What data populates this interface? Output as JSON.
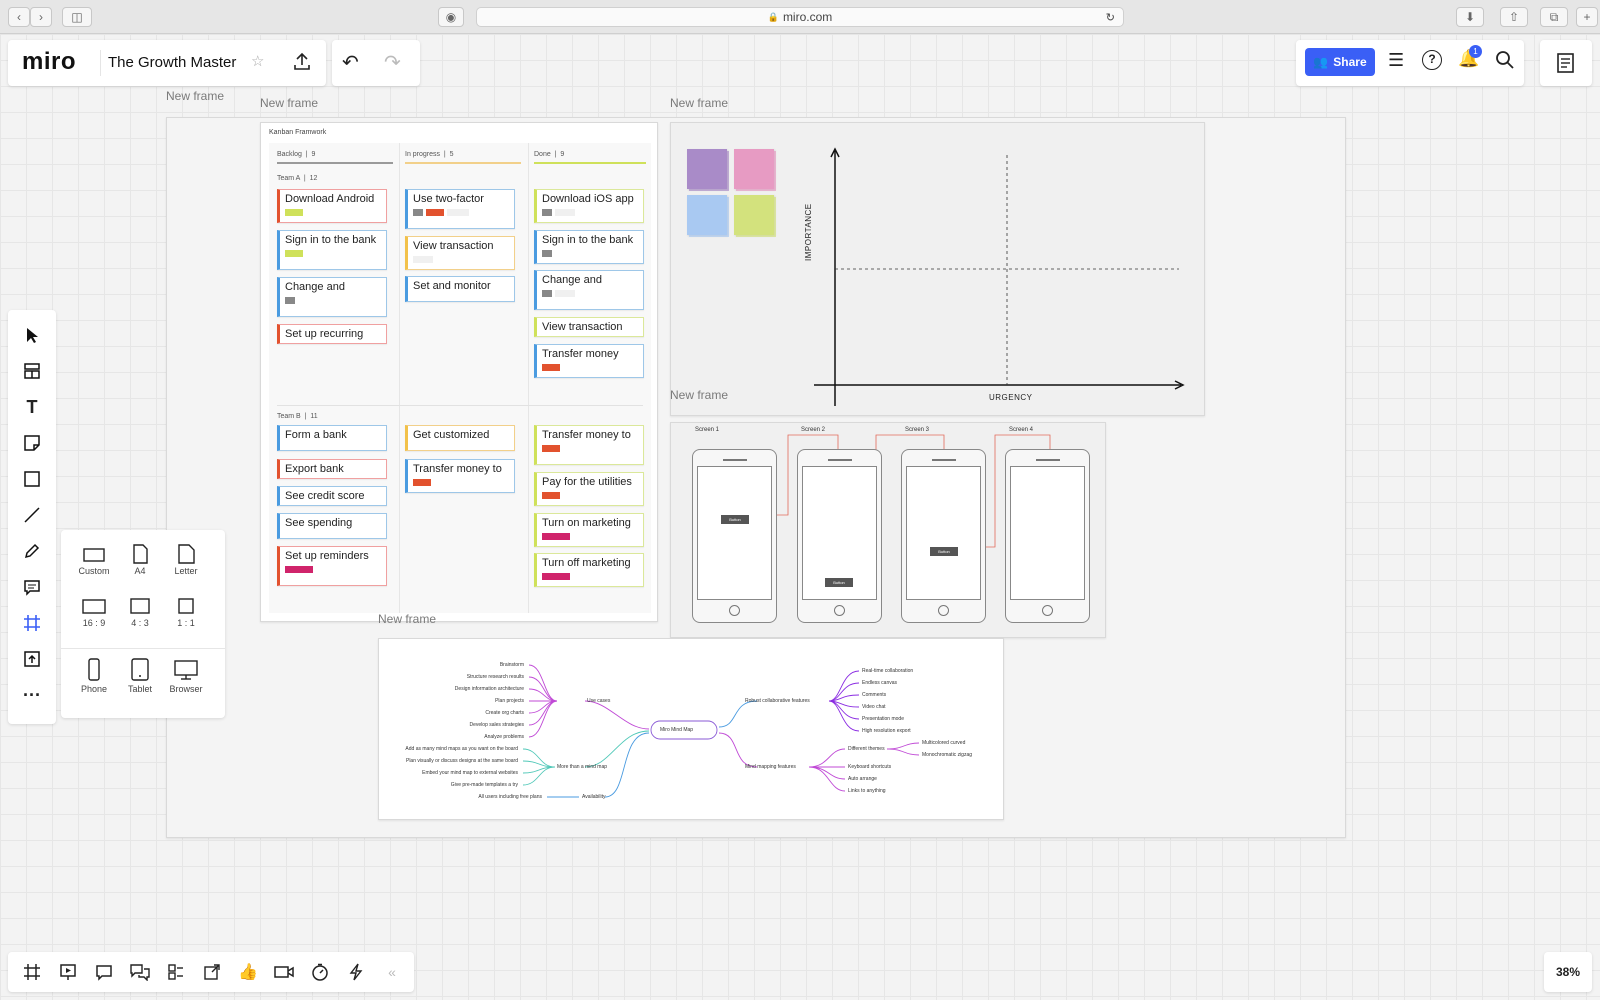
{
  "browser": {
    "url": "miro.com"
  },
  "app": {
    "logo": "miro",
    "board_title": "The Growth Master",
    "share_label": "Share",
    "notification_count": "1",
    "zoom": "38%"
  },
  "frames": {
    "outer_label": "New frame",
    "kanban_label": "New frame",
    "matrix_label": "New frame",
    "wireframe_label": "New frame",
    "mindmap_label": "New frame"
  },
  "kanban": {
    "title": "Kanban Framwork",
    "columns": [
      {
        "name": "Backlog",
        "count": "9"
      },
      {
        "name": "In progress",
        "count": "5"
      },
      {
        "name": "Done",
        "count": "9"
      }
    ],
    "team_a": {
      "name": "Team A",
      "count": "12"
    },
    "team_b": {
      "name": "Team B",
      "count": "11"
    },
    "cards": {
      "a_backlog": [
        "Download Android",
        "Sign in to the bank",
        "Change and",
        "Set up recurring"
      ],
      "a_progress": [
        "Use two-factor",
        "View transaction",
        "Set and monitor"
      ],
      "a_done": [
        "Download iOS app",
        "Sign in to the bank",
        "Change and",
        "View transaction",
        "Transfer money"
      ],
      "b_backlog": [
        "Form a bank",
        "Export bank",
        "See credit score",
        "See spending",
        "Set up reminders"
      ],
      "b_progress": [
        "Get customized",
        "Transfer money to"
      ],
      "b_done": [
        "Transfer money to",
        "Pay for the utilities",
        "Turn on marketing",
        "Turn off marketing"
      ]
    }
  },
  "matrix": {
    "y_axis": "IMPORTANCE",
    "x_axis": "URGENCY",
    "sticky_colors": [
      "#a98bc8",
      "#e79bc3",
      "#a9c9f2",
      "#d3e27d"
    ]
  },
  "wireframes": {
    "screens": [
      "Screen 1",
      "Screen 2",
      "Screen 3",
      "Screen 4"
    ],
    "buttons": [
      "Button",
      "Button",
      "Button"
    ]
  },
  "mindmap": {
    "root": "Miro Mind Map",
    "left": {
      "use_cases": "Use cases",
      "use_cases_items": [
        "Brainstorm",
        "Structure research results",
        "Design information architecture",
        "Plan projects",
        "Create org charts",
        "Develop sales strategies",
        "Analyze problems"
      ],
      "more": "More than a mind map",
      "more_items": [
        "Add as many mind maps as you want on the board",
        "Plan visually or discuss designs at the same board",
        "Embed your mind map to external websites",
        "Give pre-made templates a try"
      ],
      "availability": "Availability",
      "availability_items": [
        "All users including free plans"
      ]
    },
    "right": {
      "robust": "Robust collaborative features",
      "robust_items": [
        "Real-time collaboration",
        "Endless canvas",
        "Comments",
        "Video chat",
        "Presentation mode",
        "High resolution export"
      ],
      "features": "Mind mapping features",
      "features_items": [
        "Different themes",
        "Keyboard shortcuts",
        "Auto arrange",
        "Links to anything"
      ],
      "themes_items": [
        "Multicolored curved",
        "Monochromatic zigzag"
      ]
    }
  },
  "frame_picker": {
    "items": [
      "Custom",
      "A4",
      "Letter",
      "16 : 9",
      "4 : 3",
      "1 : 1",
      "Phone",
      "Tablet",
      "Browser"
    ]
  },
  "colors": {
    "accent": "#3a5ff6",
    "tag_green": "#cfe15a",
    "tag_red": "#e2522e",
    "tag_pink": "#d0246b",
    "tag_grey": "#888888"
  }
}
